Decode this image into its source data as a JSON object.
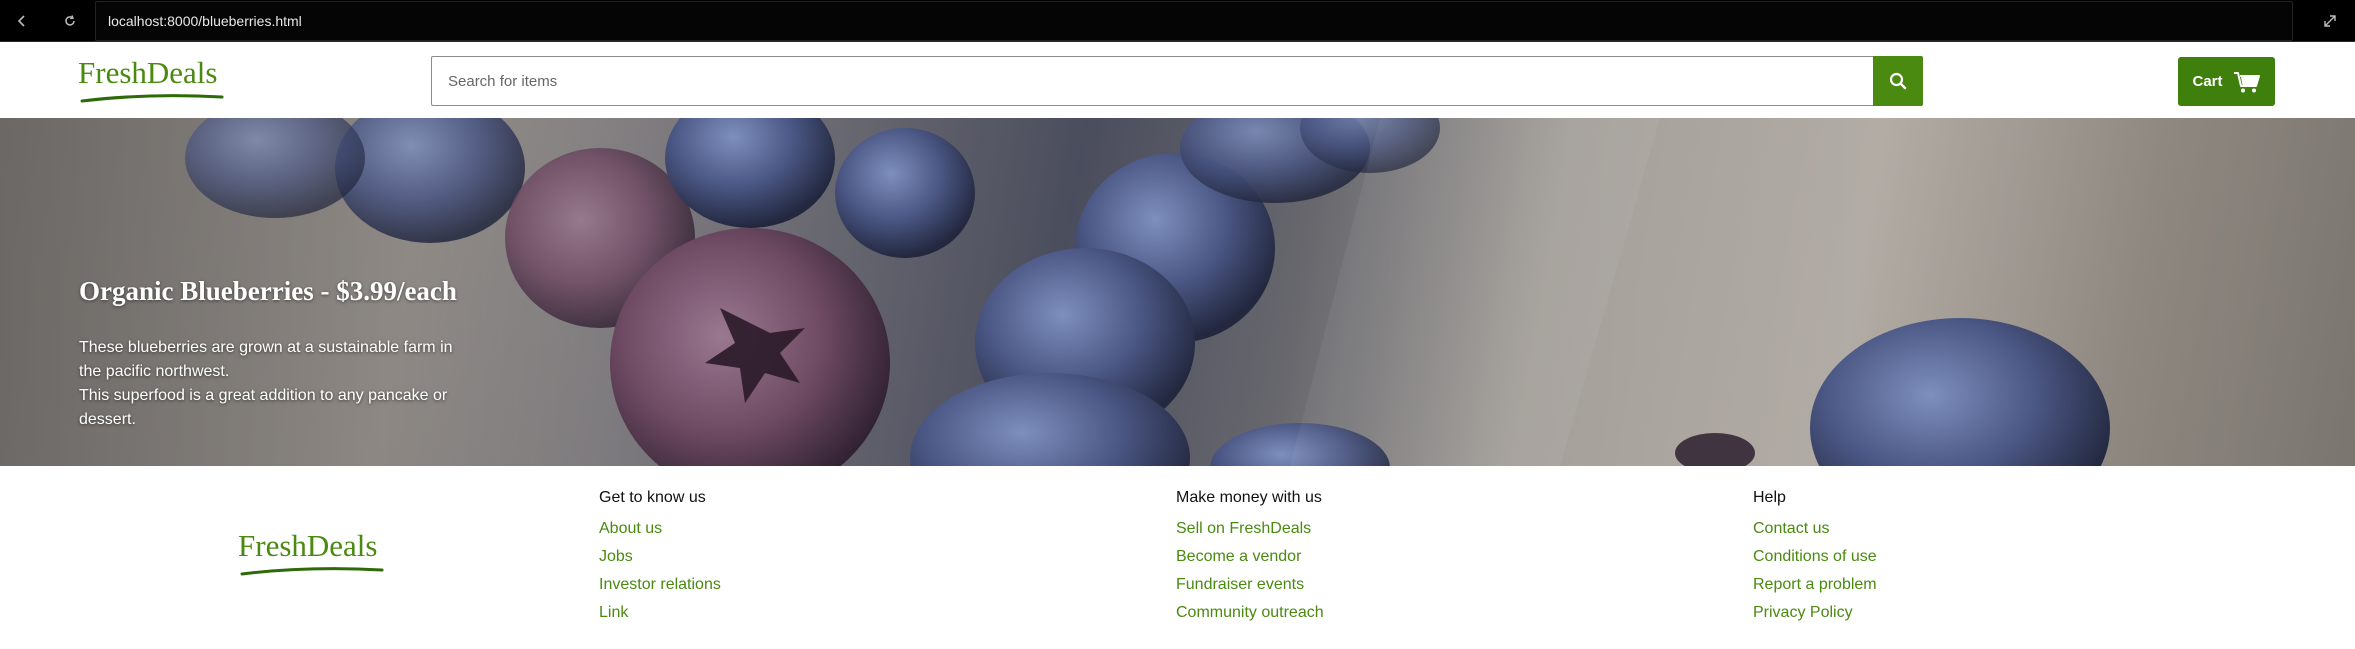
{
  "browser": {
    "url": "localhost:8000/blueberries.html",
    "icons": {
      "back": "back-arrow-icon",
      "reload": "reload-icon",
      "expand": "expand-icon"
    }
  },
  "header": {
    "logo_text": "FreshDeals",
    "search": {
      "placeholder": "Search for items",
      "value": "",
      "icon": "search-icon"
    },
    "cart_label": "Cart",
    "cart_icon": "cart-icon"
  },
  "hero": {
    "title": "Organic Blueberries - $3.99/each",
    "description": [
      "These blueberries are grown at a sustainable farm in the pacific northwest.",
      "This superfood is a great addition to any pancake or dessert."
    ]
  },
  "footer": {
    "logo_text": "FreshDeals",
    "columns": [
      {
        "heading": "Get to know us",
        "links": [
          "About us",
          "Jobs",
          "Investor relations",
          "Link"
        ]
      },
      {
        "heading": "Make money with us",
        "links": [
          "Sell on FreshDeals",
          "Become a vendor",
          "Fundraiser events",
          "Community outreach"
        ]
      },
      {
        "heading": "Help",
        "links": [
          "Contact us",
          "Conditions of use",
          "Report a problem",
          "Privacy Policy"
        ]
      }
    ]
  },
  "colors": {
    "brand_green": "#4a8a10",
    "cart_green": "#3f7f0c",
    "chrome_bg": "#000000"
  }
}
